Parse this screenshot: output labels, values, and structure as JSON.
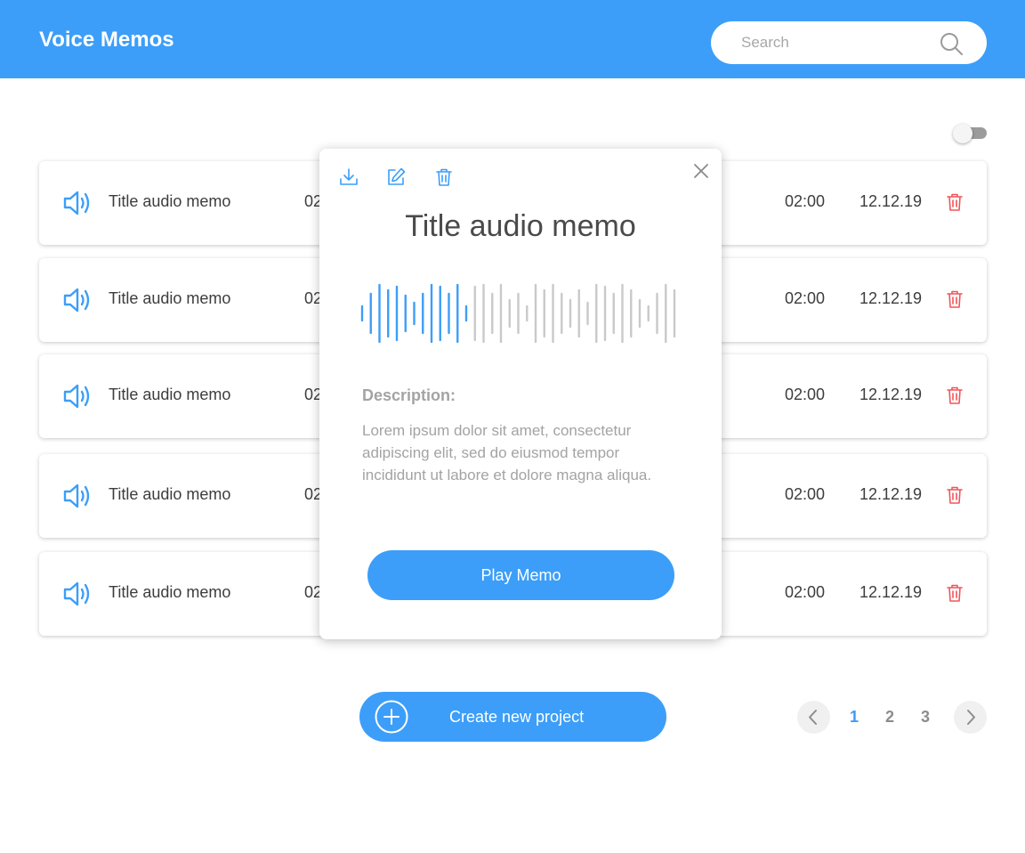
{
  "header": {
    "title": "Voice Memos"
  },
  "search": {
    "placeholder": "Search",
    "value": ""
  },
  "colors": {
    "accent": "#3c9ef8",
    "delete": "#f0555a",
    "wave_played": "#3c9ef8",
    "wave_unplayed": "#c9c9c9"
  },
  "memos": [
    {
      "title": "Title audio memo",
      "partial": "02",
      "duration": "02:00",
      "date": "12.12.19"
    },
    {
      "title": "Title audio memo",
      "partial": "02",
      "duration": "02:00",
      "date": "12.12.19"
    },
    {
      "title": "Title audio memo",
      "partial": "02",
      "duration": "02:00",
      "date": "12.12.19"
    },
    {
      "title": "Title audio memo",
      "partial": "02",
      "duration": "02:00",
      "date": "12.12.19"
    },
    {
      "title": "Title audio memo",
      "partial": "02",
      "duration": "02:00",
      "date": "12.12.19"
    }
  ],
  "popup": {
    "title": "Title audio memo",
    "description_label": "Description:",
    "description": "Lorem ipsum dolor sit amet, consectetur adipiscing elit, sed do eiusmod tempor incididunt ut labore et dolore magna aliqua.",
    "play_label": "Play Memo",
    "icons": [
      "download-icon",
      "edit-icon",
      "trash-icon",
      "close-icon"
    ]
  },
  "create_button": {
    "label": "Create new project"
  },
  "pagination": {
    "pages": [
      "1",
      "2",
      "3"
    ],
    "current": "1"
  }
}
